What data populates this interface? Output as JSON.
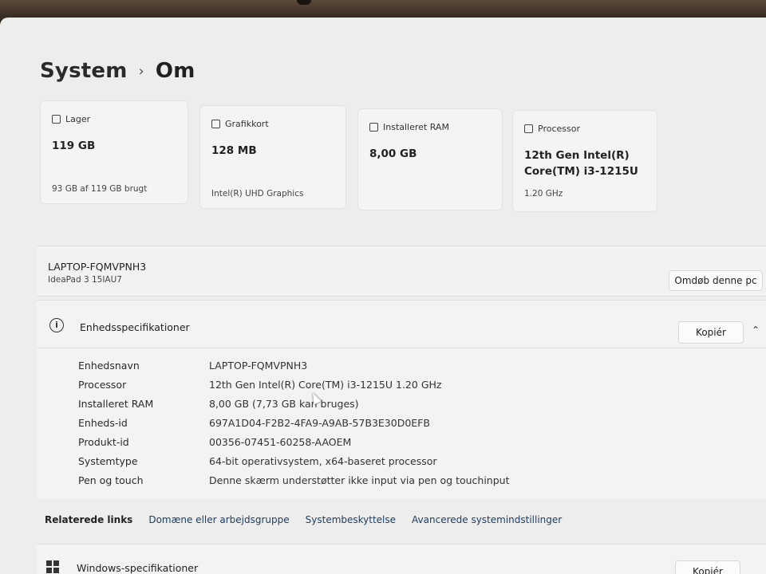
{
  "breadcrumb": {
    "parent": "System",
    "current": "Om"
  },
  "cards": [
    {
      "title": "Lager",
      "value": "119 GB",
      "sub": "93 GB af 119 GB brugt",
      "icon": "storage-icon"
    },
    {
      "title": "Grafikkort",
      "value": "128 MB",
      "sub": "Intel(R) UHD Graphics",
      "icon": "gpu-icon"
    },
    {
      "title": "Installeret RAM",
      "value": "8,00 GB",
      "sub": "",
      "icon": "ram-icon"
    },
    {
      "title": "Processor",
      "value": "12th Gen Intel(R) Core(TM) i3-1215U",
      "sub": "1.20 GHz",
      "icon": "cpu-icon"
    }
  ],
  "device": {
    "name": "LAPTOP-FQMVPNH3",
    "model": "IdeaPad 3 15IAU7",
    "rename_label": "Omdøb denne pc"
  },
  "specs": {
    "title": "Enhedsspecifikationer",
    "copy_label": "Kopiér",
    "rows": [
      {
        "key": "Enhedsnavn",
        "value": "LAPTOP-FQMVPNH3"
      },
      {
        "key": "Processor",
        "value": "12th Gen Intel(R) Core(TM) i3-1215U   1.20 GHz"
      },
      {
        "key": "Installeret RAM",
        "value": "8,00 GB (7,73 GB kan bruges)"
      },
      {
        "key": "Enheds-id",
        "value": "697A1D04-F2B2-4FA9-A9AB-57B3E30D0EFB"
      },
      {
        "key": "Produkt-id",
        "value": "00356-07451-60258-AAOEM"
      },
      {
        "key": "Systemtype",
        "value": "64-bit operativsystem, x64-baseret processor"
      },
      {
        "key": "Pen og touch",
        "value": "Denne skærm understøtter ikke input via pen og touchinput"
      }
    ]
  },
  "related": {
    "label": "Relaterede links",
    "links": [
      "Domæne eller arbejdsgruppe",
      "Systembeskyttelse",
      "Avancerede systemindstillinger"
    ]
  },
  "windows_specs": {
    "title": "Windows-specifikationer",
    "copy_label": "Kopiér"
  }
}
